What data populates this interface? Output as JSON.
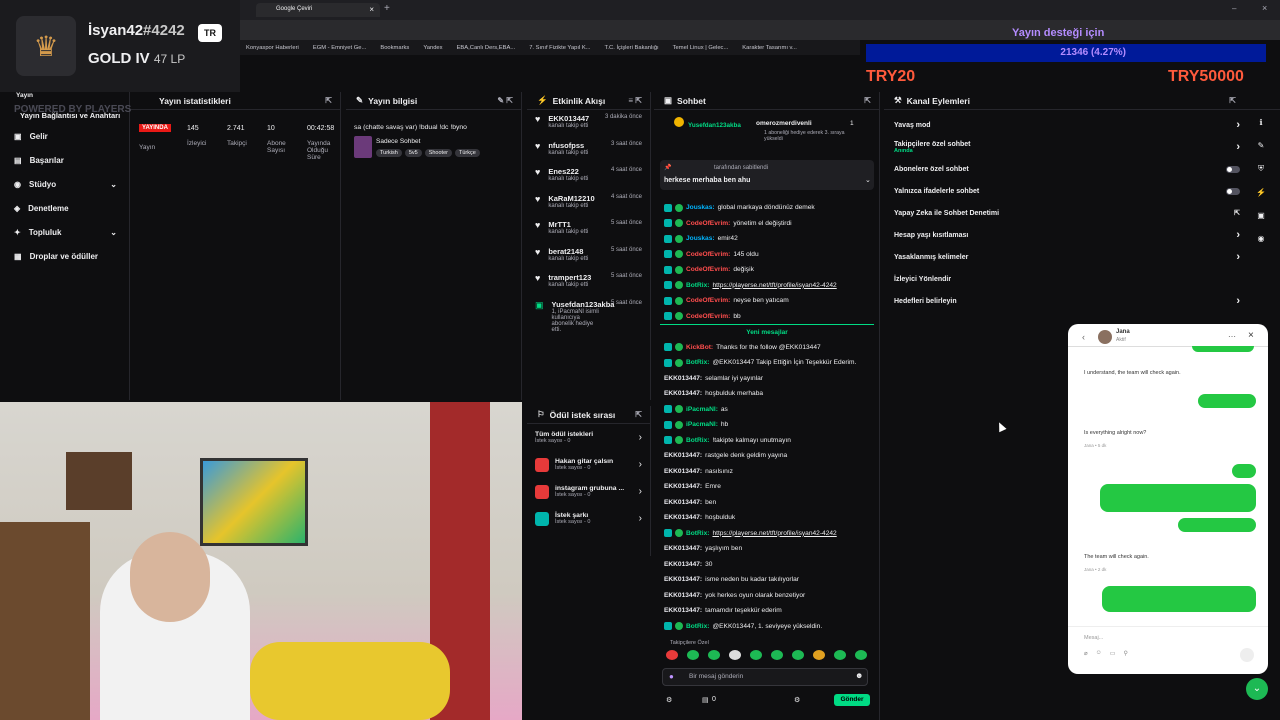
{
  "browser": {
    "tab_title": "Google Çeviri",
    "bookmarks": [
      "Konyaspor Haberleri",
      "EGM - Emniyet Ge...",
      "Bookmarks",
      "Yandex",
      "EBA,Canlı Ders,EBA...",
      "7. Sınıf Fizikte Yapıl K...",
      "T.C. İçişleri Bakanlığı",
      "Temel Linux | Gelec...",
      "Karakter Tasarımı v..."
    ]
  },
  "rank": {
    "name": "İsyan42",
    "tag": "#4242",
    "region": "TR",
    "tier": "GOLD IV",
    "lp": "47 LP",
    "watermark": "POWERED BY PLAYERSE.NET/TFT"
  },
  "stream_overlay": {
    "donation_title": "Yayın desteği için",
    "donation_value": "21346 (4.27%)",
    "left_code": "TRY20",
    "right_code": "TRY50000"
  },
  "sidebar": {
    "top_label": "Yayın",
    "items": [
      {
        "label": "Yayın Bağlantısı ve Anahtarı"
      },
      {
        "label": "Gelir"
      },
      {
        "label": "Başarılar"
      },
      {
        "label": "Stüdyo"
      },
      {
        "label": "Denetleme"
      },
      {
        "label": "Topluluk"
      },
      {
        "label": "Droplar ve ödüller"
      }
    ]
  },
  "stats": {
    "title": "Yayın istatistikleri",
    "live": "YAYINDA",
    "live_sub": "Yayın",
    "viewers": "145",
    "viewers_label": "İzleyici",
    "followers": "2.741",
    "followers_label": "Takipçi",
    "subs": "10",
    "subs_label": "Abone Sayısı",
    "uptime": "00:42:58",
    "uptime_label": "Yayında Olduğu Süre"
  },
  "stream_info": {
    "title": "Yayın bilgisi",
    "stream_title": "sa (chatte savaş var) !bdual !dc !byno",
    "category": "Sadece Sohbet",
    "tags": [
      "Turkish",
      "5v5",
      "Shooter",
      "Türkçe"
    ]
  },
  "activity": {
    "title": "Etkinlik Akışı",
    "items": [
      {
        "name": "EKK013447",
        "sub": "kanalı takip etti",
        "time": "3 dakika önce"
      },
      {
        "name": "nfusofpss",
        "sub": "kanalı takip etti",
        "time": "3 saat önce"
      },
      {
        "name": "Enes222",
        "sub": "kanalı takip etti",
        "time": "4 saat önce"
      },
      {
        "name": "KaRaM12210",
        "sub": "kanalı takip etti",
        "time": "4 saat önce"
      },
      {
        "name": "MrTT1",
        "sub": "kanalı takip etti",
        "time": "5 saat önce"
      },
      {
        "name": "berat2148",
        "sub": "kanalı takip etti",
        "time": "5 saat önce"
      },
      {
        "name": "trampert123",
        "sub": "kanalı takip etti",
        "time": "5 saat önce"
      },
      {
        "name": "Yusefdan123akba",
        "sub": "1, iPacmaNl isimli kullanıcıya abonelik hediye etti.",
        "time": "5 saat önce"
      }
    ]
  },
  "rewards": {
    "title": "Ödül istek sırası",
    "items": [
      {
        "name": "Tüm ödül istekleri",
        "sub": "İstek sayısı - 0"
      },
      {
        "name": "Hakan gitar çalsın",
        "sub": "İstek sayısı - 0"
      },
      {
        "name": "instagram grubuna ...",
        "sub": "İstek sayısı - 0"
      },
      {
        "name": "İstek şarkı",
        "sub": "İstek sayısı - 0"
      }
    ]
  },
  "chat": {
    "title": "Sohbet",
    "pinned_user": "Yusefdan123akba",
    "pinned_gift_user": "omerozmerdivenli",
    "pinned_gift_text": "1 aboneliği hediye ederek 3. sıraya yükseldi",
    "pinned_gift_count": "1",
    "pin_by": "tarafından sabitlendi",
    "pin_text": "herkese merhaba ben ahu",
    "new_messages": "Yeni mesajlar",
    "messages": [
      {
        "user": "Jouskas:",
        "text": "global markaya döndünüz demek",
        "color": "#00b5ff"
      },
      {
        "user": "CodeOfEvrim:",
        "text": "yönetim el değiştirdi",
        "color": "#ff4d4d"
      },
      {
        "user": "Jouskas:",
        "text": "emir42",
        "color": "#00b5ff"
      },
      {
        "user": "CodeOfEvrim:",
        "text": "145 oldu",
        "color": "#ff4d4d"
      },
      {
        "user": "CodeOfEvrim:",
        "text": "değişik",
        "color": "#ff4d4d"
      },
      {
        "user": "BotRix:",
        "text": "https://playerse.net/tft/profile/isyan42-4242",
        "color": "#00db84",
        "link": true
      },
      {
        "user": "CodeOfEvrim:",
        "text": "neyse ben yatıcam",
        "color": "#ff4d4d"
      },
      {
        "user": "CodeOfEvrim:",
        "text": "bb",
        "color": "#ff4d4d"
      },
      {
        "user": "KickBot:",
        "text": "Thanks for the follow @EKK013447",
        "color": "#ff4d4d"
      },
      {
        "user": "BotRix:",
        "text": "@EKK013447 Takip Ettiğin İçin Teşekkür Ederim.",
        "color": "#00db84"
      },
      {
        "user": "EKK013447:",
        "text": "selamlar iyi yayınlar",
        "color": "#e8e8ee"
      },
      {
        "user": "EKK013447:",
        "text": "hoşbulduk merhaba",
        "color": "#e8e8ee"
      },
      {
        "user": "iPacmaNl:",
        "text": "as",
        "color": "#00db84"
      },
      {
        "user": "iPacmaNl:",
        "text": "hb",
        "color": "#00db84"
      },
      {
        "user": "BotRix:",
        "text": "!takipte kalmayı unutmayın",
        "color": "#00db84"
      },
      {
        "user": "EKK013447:",
        "text": "rastgele denk geldim yayına",
        "color": "#e8e8ee"
      },
      {
        "user": "EKK013447:",
        "text": "nasılsınız",
        "color": "#e8e8ee"
      },
      {
        "user": "EKK013447:",
        "text": "Emre",
        "color": "#e8e8ee"
      },
      {
        "user": "EKK013447:",
        "text": "ben",
        "color": "#e8e8ee"
      },
      {
        "user": "EKK013447:",
        "text": "hoşbulduk",
        "color": "#e8e8ee"
      },
      {
        "user": "BotRix:",
        "text": "https://playerse.net/tft/profile/isyan42-4242",
        "color": "#00db84",
        "link": true
      },
      {
        "user": "EKK013447:",
        "text": "yaşlıyım ben",
        "color": "#e8e8ee"
      },
      {
        "user": "EKK013447:",
        "text": "30",
        "color": "#e8e8ee"
      },
      {
        "user": "EKK013447:",
        "text": "isme neden bu kadar takılıyorlar",
        "color": "#e8e8ee"
      },
      {
        "user": "EKK013447:",
        "text": "yok herkes oyun olarak benzetiyor",
        "color": "#e8e8ee"
      },
      {
        "user": "EKK013447:",
        "text": "tamamdır teşekkür ederim",
        "color": "#e8e8ee"
      },
      {
        "user": "BotRix:",
        "text": "@EKK013447, 1. seviyeye yükseldin.",
        "color": "#00db84"
      }
    ],
    "followers_only": "Takipçilere Özel",
    "input_placeholder": "Bir mesaj gönderin",
    "points": "0",
    "send": "Gönder"
  },
  "channel": {
    "title": "Kanal Eylemleri",
    "rows": [
      {
        "label": "Yavaş mod",
        "kind": "arrow"
      },
      {
        "label": "Takipçilere özel sohbet",
        "sub": "Anında",
        "kind": "arrow"
      },
      {
        "label": "Abonelere özel sohbet",
        "kind": "toggle"
      },
      {
        "label": "Yalnızca ifadelerle sohbet",
        "kind": "toggle"
      },
      {
        "label": "Yapay Zeka ile Sohbet Denetimi",
        "kind": "ext"
      },
      {
        "label": "Hesap yaşı kısıtlaması",
        "kind": "arrow"
      },
      {
        "label": "Yasaklanmış kelimeler",
        "kind": "arrow"
      },
      {
        "label": "İzleyici Yönlendir",
        "kind": "none"
      },
      {
        "label": "Hedefleri belirleyin",
        "kind": "arrow"
      }
    ]
  },
  "messenger": {
    "name": "Jana",
    "status": "Aktif",
    "msg1": "I understand, the team will check again.",
    "msg2": "Is everything alright now?",
    "msg2_meta": "Jana • 5 dk",
    "msg3": "The team will check again.",
    "msg3_meta": "Jana • 2 dk",
    "input": "Mesaj..."
  }
}
